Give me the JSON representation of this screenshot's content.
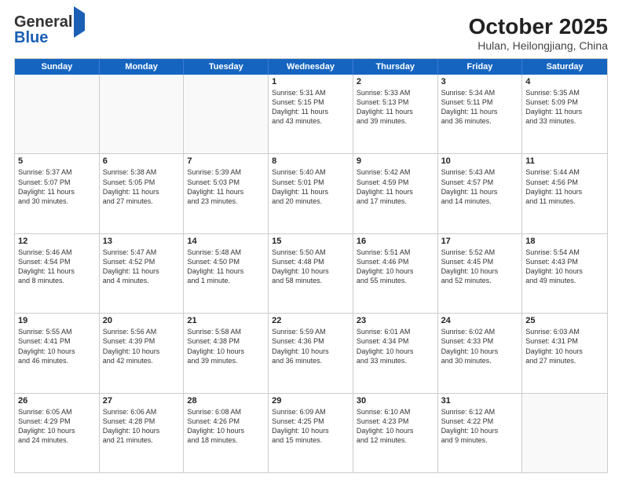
{
  "header": {
    "logo_line1": "General",
    "logo_line2": "Blue",
    "month_year": "October 2025",
    "location": "Hulan, Heilongjiang, China"
  },
  "weekdays": [
    "Sunday",
    "Monday",
    "Tuesday",
    "Wednesday",
    "Thursday",
    "Friday",
    "Saturday"
  ],
  "rows": [
    [
      {
        "day": "",
        "info": ""
      },
      {
        "day": "",
        "info": ""
      },
      {
        "day": "",
        "info": ""
      },
      {
        "day": "1",
        "info": "Sunrise: 5:31 AM\nSunset: 5:15 PM\nDaylight: 11 hours\nand 43 minutes."
      },
      {
        "day": "2",
        "info": "Sunrise: 5:33 AM\nSunset: 5:13 PM\nDaylight: 11 hours\nand 39 minutes."
      },
      {
        "day": "3",
        "info": "Sunrise: 5:34 AM\nSunset: 5:11 PM\nDaylight: 11 hours\nand 36 minutes."
      },
      {
        "day": "4",
        "info": "Sunrise: 5:35 AM\nSunset: 5:09 PM\nDaylight: 11 hours\nand 33 minutes."
      }
    ],
    [
      {
        "day": "5",
        "info": "Sunrise: 5:37 AM\nSunset: 5:07 PM\nDaylight: 11 hours\nand 30 minutes."
      },
      {
        "day": "6",
        "info": "Sunrise: 5:38 AM\nSunset: 5:05 PM\nDaylight: 11 hours\nand 27 minutes."
      },
      {
        "day": "7",
        "info": "Sunrise: 5:39 AM\nSunset: 5:03 PM\nDaylight: 11 hours\nand 23 minutes."
      },
      {
        "day": "8",
        "info": "Sunrise: 5:40 AM\nSunset: 5:01 PM\nDaylight: 11 hours\nand 20 minutes."
      },
      {
        "day": "9",
        "info": "Sunrise: 5:42 AM\nSunset: 4:59 PM\nDaylight: 11 hours\nand 17 minutes."
      },
      {
        "day": "10",
        "info": "Sunrise: 5:43 AM\nSunset: 4:57 PM\nDaylight: 11 hours\nand 14 minutes."
      },
      {
        "day": "11",
        "info": "Sunrise: 5:44 AM\nSunset: 4:56 PM\nDaylight: 11 hours\nand 11 minutes."
      }
    ],
    [
      {
        "day": "12",
        "info": "Sunrise: 5:46 AM\nSunset: 4:54 PM\nDaylight: 11 hours\nand 8 minutes."
      },
      {
        "day": "13",
        "info": "Sunrise: 5:47 AM\nSunset: 4:52 PM\nDaylight: 11 hours\nand 4 minutes."
      },
      {
        "day": "14",
        "info": "Sunrise: 5:48 AM\nSunset: 4:50 PM\nDaylight: 11 hours\nand 1 minute."
      },
      {
        "day": "15",
        "info": "Sunrise: 5:50 AM\nSunset: 4:48 PM\nDaylight: 10 hours\nand 58 minutes."
      },
      {
        "day": "16",
        "info": "Sunrise: 5:51 AM\nSunset: 4:46 PM\nDaylight: 10 hours\nand 55 minutes."
      },
      {
        "day": "17",
        "info": "Sunrise: 5:52 AM\nSunset: 4:45 PM\nDaylight: 10 hours\nand 52 minutes."
      },
      {
        "day": "18",
        "info": "Sunrise: 5:54 AM\nSunset: 4:43 PM\nDaylight: 10 hours\nand 49 minutes."
      }
    ],
    [
      {
        "day": "19",
        "info": "Sunrise: 5:55 AM\nSunset: 4:41 PM\nDaylight: 10 hours\nand 46 minutes."
      },
      {
        "day": "20",
        "info": "Sunrise: 5:56 AM\nSunset: 4:39 PM\nDaylight: 10 hours\nand 42 minutes."
      },
      {
        "day": "21",
        "info": "Sunrise: 5:58 AM\nSunset: 4:38 PM\nDaylight: 10 hours\nand 39 minutes."
      },
      {
        "day": "22",
        "info": "Sunrise: 5:59 AM\nSunset: 4:36 PM\nDaylight: 10 hours\nand 36 minutes."
      },
      {
        "day": "23",
        "info": "Sunrise: 6:01 AM\nSunset: 4:34 PM\nDaylight: 10 hours\nand 33 minutes."
      },
      {
        "day": "24",
        "info": "Sunrise: 6:02 AM\nSunset: 4:33 PM\nDaylight: 10 hours\nand 30 minutes."
      },
      {
        "day": "25",
        "info": "Sunrise: 6:03 AM\nSunset: 4:31 PM\nDaylight: 10 hours\nand 27 minutes."
      }
    ],
    [
      {
        "day": "26",
        "info": "Sunrise: 6:05 AM\nSunset: 4:29 PM\nDaylight: 10 hours\nand 24 minutes."
      },
      {
        "day": "27",
        "info": "Sunrise: 6:06 AM\nSunset: 4:28 PM\nDaylight: 10 hours\nand 21 minutes."
      },
      {
        "day": "28",
        "info": "Sunrise: 6:08 AM\nSunset: 4:26 PM\nDaylight: 10 hours\nand 18 minutes."
      },
      {
        "day": "29",
        "info": "Sunrise: 6:09 AM\nSunset: 4:25 PM\nDaylight: 10 hours\nand 15 minutes."
      },
      {
        "day": "30",
        "info": "Sunrise: 6:10 AM\nSunset: 4:23 PM\nDaylight: 10 hours\nand 12 minutes."
      },
      {
        "day": "31",
        "info": "Sunrise: 6:12 AM\nSunset: 4:22 PM\nDaylight: 10 hours\nand 9 minutes."
      },
      {
        "day": "",
        "info": ""
      }
    ]
  ]
}
